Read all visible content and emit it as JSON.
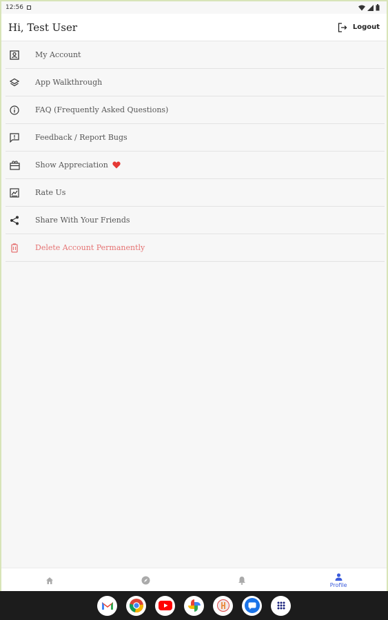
{
  "status": {
    "time": "12:56"
  },
  "header": {
    "greeting": "Hi, Test User",
    "logout_label": "Logout"
  },
  "menu": {
    "items": [
      {
        "label": "My Account",
        "icon": "account-box-icon"
      },
      {
        "label": "App Walkthrough",
        "icon": "layers-icon"
      },
      {
        "label": "FAQ (Frequently Asked Questions)",
        "icon": "info-icon"
      },
      {
        "label": "Feedback / Report Bugs",
        "icon": "feedback-icon"
      },
      {
        "label": "Show Appreciation",
        "icon": "gift-icon"
      },
      {
        "label": "Rate Us",
        "icon": "rate-icon"
      },
      {
        "label": "Share With Your Friends",
        "icon": "share-icon"
      },
      {
        "label": "Delete Account Permanently",
        "icon": "delete-icon"
      }
    ]
  },
  "bottom_nav": {
    "active_label": "Profile"
  },
  "colors": {
    "accent": "#3b5bdb",
    "danger": "#e57373",
    "heart": "#e53935"
  }
}
